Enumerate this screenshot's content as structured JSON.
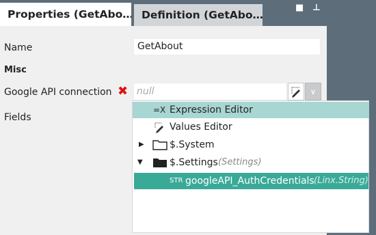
{
  "tabs": [
    {
      "label": "Properties (GetAbo…",
      "active": true
    },
    {
      "label": "Definition (GetAbo…",
      "active": false
    }
  ],
  "tab_controls": {
    "pin_glyph": "■",
    "dock_glyph": "⊥"
  },
  "properties": {
    "name_label": "Name",
    "name_value": "GetAbout",
    "section_misc": "Misc",
    "api_label": "Google API connection",
    "api_placeholder": "null",
    "fields_label": "Fields"
  },
  "dropdown": {
    "items": [
      {
        "label": "Expression Editor",
        "icon": "expression-icon",
        "glyph": "=X",
        "state": "hover"
      },
      {
        "label": "Values Editor",
        "icon": "pen-icon",
        "state": "normal"
      },
      {
        "label": "$.System",
        "icon": "folder-icon",
        "expander": "▶",
        "state": "normal"
      },
      {
        "label": "$.Settings",
        "suffix": "(Settings)",
        "icon": "folder-open-icon",
        "expander": "▼",
        "state": "normal"
      },
      {
        "label": "googleAPI_AuthCredentials",
        "type_tag": "STR",
        "suffix": "(Linx.String)",
        "state": "selected"
      }
    ]
  },
  "colors": {
    "chrome": "#5d6d7a",
    "hover": "#a8d6d2",
    "selected": "#3aaa98",
    "error": "#e01010"
  }
}
